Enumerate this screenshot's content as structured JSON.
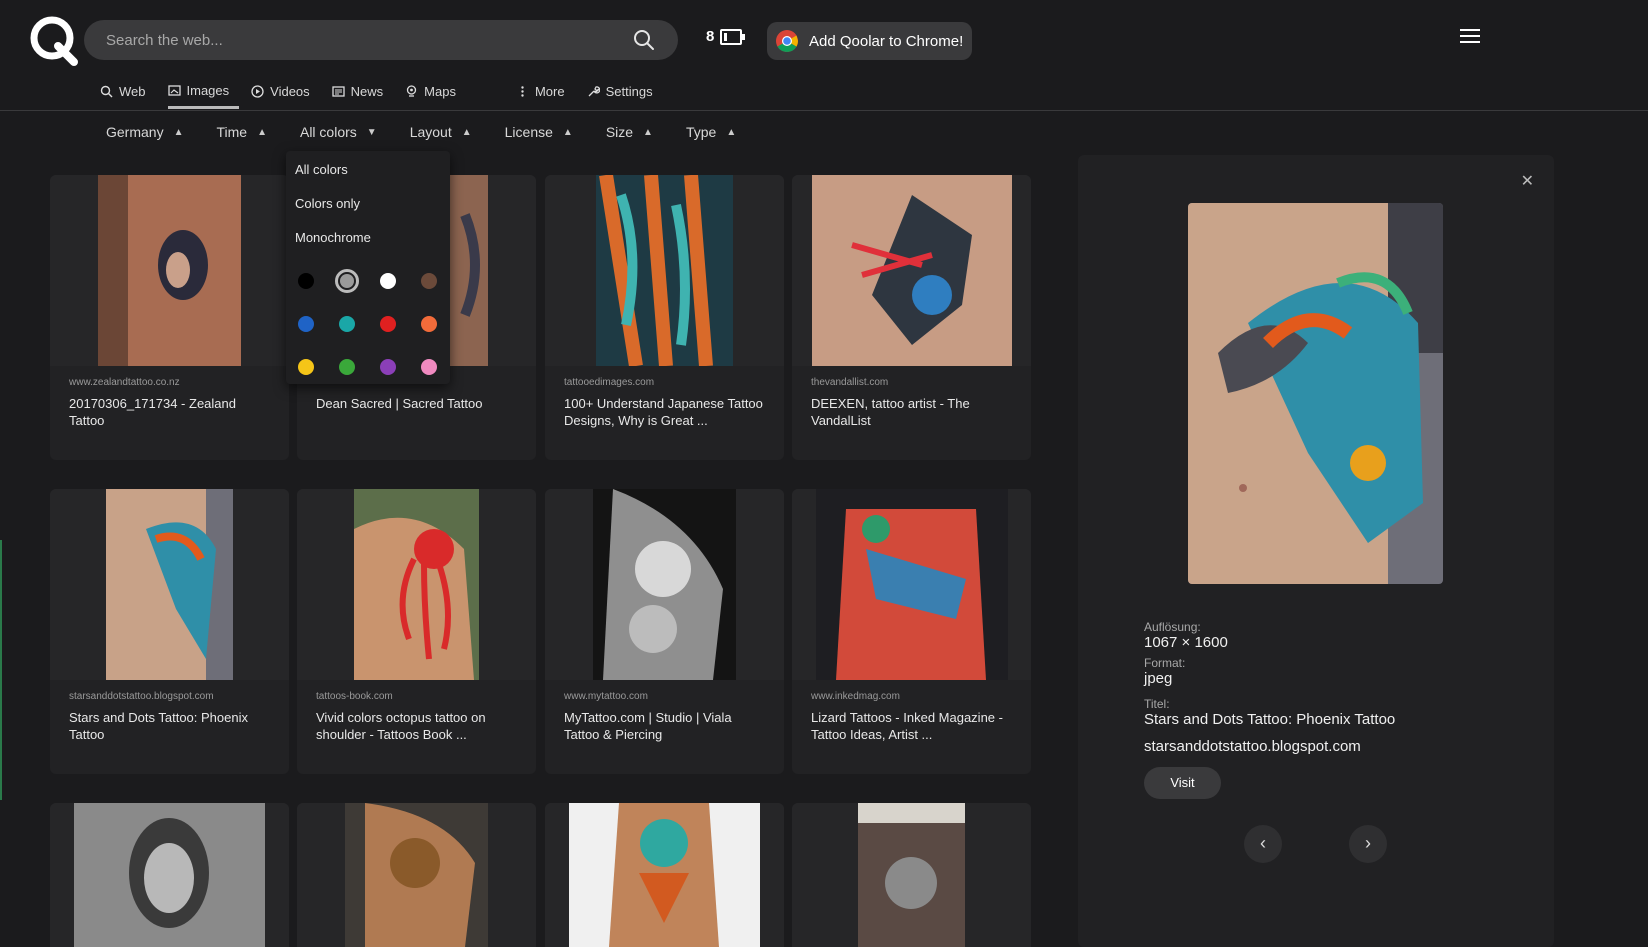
{
  "header": {
    "search_placeholder": "Search the web...",
    "counter": "8",
    "chrome_button": "Add Qoolar to Chrome!"
  },
  "nav": {
    "tabs": [
      {
        "label": "Web",
        "icon": "search-icon"
      },
      {
        "label": "Images",
        "icon": "image-icon"
      },
      {
        "label": "Videos",
        "icon": "play-icon"
      },
      {
        "label": "News",
        "icon": "news-icon"
      },
      {
        "label": "Maps",
        "icon": "map-pin-icon"
      },
      {
        "label": "More",
        "icon": "more-dots-icon"
      },
      {
        "label": "Settings",
        "icon": "wrench-icon"
      }
    ],
    "active": "Images"
  },
  "filters": {
    "region": "Germany",
    "time": "Time",
    "colors": "All colors",
    "layout": "Layout",
    "license": "License",
    "size": "Size",
    "type": "Type"
  },
  "color_dropdown": {
    "options": [
      "All colors",
      "Colors only",
      "Monochrome"
    ],
    "swatches": [
      "#000000",
      "#9a9a9a",
      "#ffffff",
      "#6b4a3a",
      "#1f63c6",
      "#1aa7a7",
      "#e02020",
      "#f26b3a",
      "#f5c518",
      "#3aa83a",
      "#8b3fb8",
      "#f08ac0"
    ],
    "selected_swatch": "#9a9a9a"
  },
  "results": [
    {
      "source": "www.zealandtattoo.co.nz",
      "title": "20170306_171734 - Zealand Tattoo"
    },
    {
      "source": "",
      "title": "Dean Sacred | Sacred Tattoo"
    },
    {
      "source": "tattooedimages.com",
      "title": "100+ Understand Japanese Tattoo Designs, Why is Great ..."
    },
    {
      "source": "thevandallist.com",
      "title": "DEEXEN, tattoo artist - The VandalList"
    },
    {
      "source": "starsanddotstattoo.blogspot.com",
      "title": "Stars and Dots Tattoo: Phoenix Tattoo"
    },
    {
      "source": "tattoos-book.com",
      "title": "Vivid colors octopus tattoo on shoulder - Tattoos Book ..."
    },
    {
      "source": "www.mytattoo.com",
      "title": "MyTattoo.com | Studio | Viala Tattoo & Piercing"
    },
    {
      "source": "www.inkedmag.com",
      "title": "Lizard Tattoos - Inked Magazine - Tattoo Ideas, Artist ..."
    }
  ],
  "panel": {
    "resolution_label": "Auflösung:",
    "resolution": "1067 × 1600",
    "format_label": "Format:",
    "format": "jpeg",
    "title_label": "Titel:",
    "title": "Stars and Dots Tattoo: Phoenix Tattoo",
    "domain": "starsanddotstattoo.blogspot.com",
    "visit": "Visit",
    "prev": "‹",
    "next": "›",
    "close": "✕"
  }
}
